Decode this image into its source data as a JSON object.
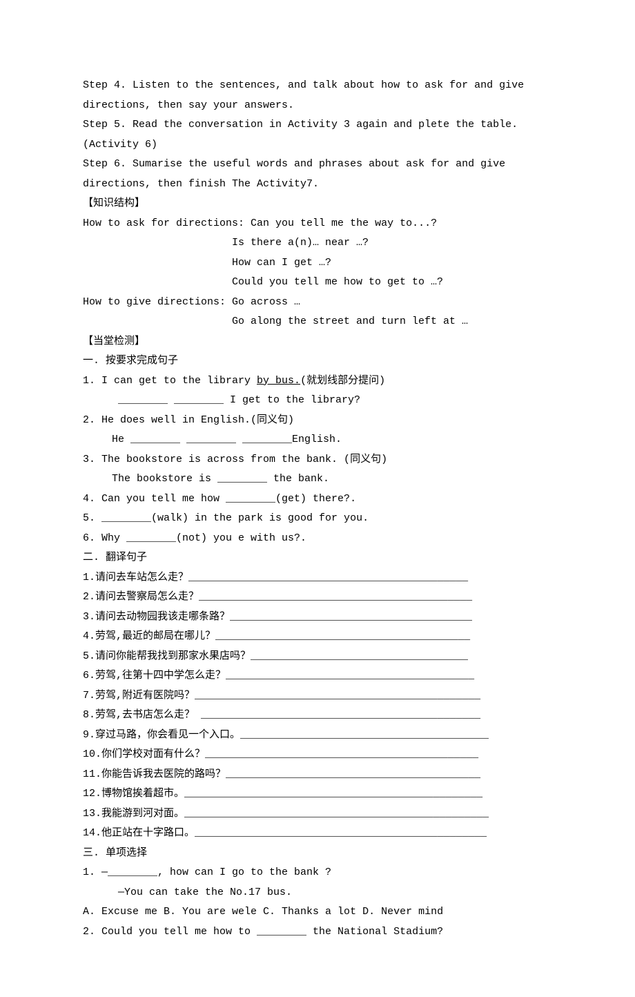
{
  "steps": {
    "s4": "Step 4.  Listen to the sentences, and talk about how to ask for and give directions, then say your answers.",
    "s5": "Step 5.  Read the conversation in Activity 3 again and plete the table.(Activity 6)",
    "s6": "Step 6. Sumarise the useful words and phrases about ask for and give directions, then finish The Activity7."
  },
  "knowledge": {
    "heading": "【知识结构】",
    "ask_intro": "How to ask for directions: Can you tell me the way to...?",
    "ask2": "Is there a(n)… near …?",
    "ask3": "How can I get …?",
    "ask4": "Could you tell me how to get to …?",
    "give_intro": "How to give directions: Go across …",
    "give2": "Go along the street and turn left at …"
  },
  "test": {
    "heading": "【当堂检测】",
    "sectionA": "一. 按要求完成句子",
    "a1_pre": "1. I can get to the library ",
    "a1_u": "by bus.",
    "a1_post": "(就划线部分提问)",
    "a1_blank": "   ________ ________ I get to the library?",
    "a2": "2. He does well in English.(同义句)",
    "a2_blank": "  He ________ ________ ________English.",
    "a3": "3. The bookstore is across from the bank. (同义句)",
    "a3_blank": "  The bookstore is ________ the bank.",
    "a4": "4. Can you tell me how ________(get) there?.",
    "a5": "5. ________(walk) in the park is good for you.",
    "a6": "6. Why ________(not) you e with us?.",
    "sectionB": "二. 翻译句子",
    "b1": "1.请问去车站怎么走？_____________________________________________",
    "b2": "2.请问去警察局怎么走？____________________________________________",
    "b3": "3.请问去动物园我该走哪条路？_______________________________________",
    "b4": "4.劳驾,最近的邮局在哪儿？_________________________________________",
    "b5": "5.请问你能帮我找到那家水果店吗？___________________________________",
    "b6": "6.劳驾,往第十四中学怎么走？________________________________________",
    "b7": "7.劳驾,附近有医院吗？______________________________________________",
    "b8": "8.劳驾,去书店怎么走？ _____________________________________________",
    "b9": "9.穿过马路，你会看见一个入口。________________________________________",
    "b10": "10.你们学校对面有什么？____________________________________________",
    "b11": "11.你能告诉我去医院的路吗？_________________________________________",
    "b12": "12.博物馆挨着超市。________________________________________________",
    "b13": "13.我能游到河对面。_________________________________________________",
    "b14": "14.他正站在十字路口。_______________________________________________",
    "sectionC": "三. 单项选择",
    "c1": "1. —________, how can I go to the bank ?",
    "c1r": "   —You can take the No.17 bus.",
    "c1opts": "A. Excuse me  B. You are wele C. Thanks a lot  D. Never mind",
    "c2": "2. Could you tell me how to  ________ the National Stadium?"
  }
}
